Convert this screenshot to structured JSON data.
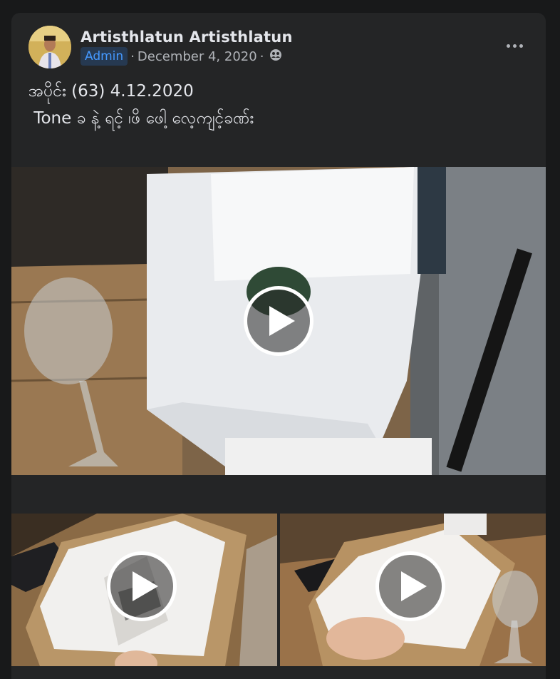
{
  "post": {
    "author": "Artisthlatun Artisthlatun",
    "badge": "Admin",
    "date": "December 4, 2020",
    "separator": "·",
    "privacy_icon": "group-icon",
    "text_line1": "အပိုင်း (63) 4.12.2020",
    "text_line2": " Tone ခ နဲ့ ရင့် ၊ဖိ ဖေါ့ လေ့ကျင့်ခဏ်း"
  },
  "media": {
    "items": [
      {
        "type": "video",
        "icon": "play-icon"
      },
      {
        "type": "video",
        "icon": "play-icon"
      },
      {
        "type": "video",
        "icon": "play-icon"
      }
    ]
  },
  "colors": {
    "background": "#18191a",
    "card": "#242526",
    "badge_bg": "#263951",
    "badge_text": "#4599ff",
    "secondary_text": "#b0b3b8"
  }
}
